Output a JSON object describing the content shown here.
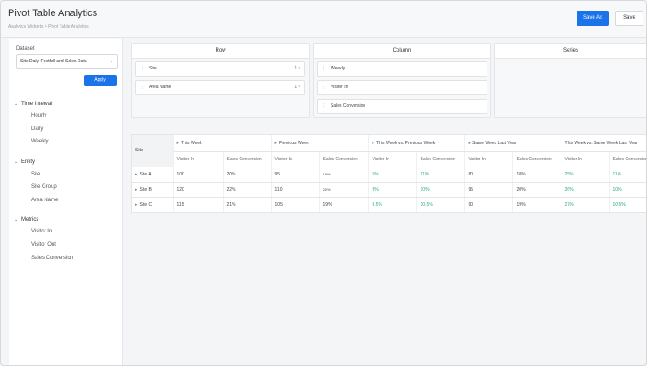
{
  "header": {
    "title": "Pivot Table Analytics",
    "breadcrumb": "Analytics Widgets  >  Pivot Table Analytics",
    "save_as_label": "Save As",
    "save_label": "Save"
  },
  "sidebar": {
    "dataset_label": "Dataset",
    "dataset_value": "Site Daily Footfall and Sales Data",
    "apply_label": "Apply",
    "groups": [
      {
        "label": "Time Interval",
        "items": [
          "Hourly",
          "Daily",
          "Weekly"
        ]
      },
      {
        "label": "Entity",
        "items": [
          "Site",
          "Site Group",
          "Area Name"
        ]
      },
      {
        "label": "Metrics",
        "items": [
          "Visitor In",
          "Visitor Out",
          "Sales Conversion"
        ]
      }
    ]
  },
  "zones": {
    "row": {
      "title": "Row",
      "chips": [
        "Site",
        "Area Name"
      ],
      "chip_index": "1"
    },
    "column": {
      "title": "Column",
      "chips": [
        "Weekly",
        "Visitor In",
        "Sales Conversion"
      ]
    },
    "series": {
      "title": "Series"
    }
  },
  "table": {
    "row_header": "Site",
    "groups": [
      "This Week",
      "Previous Week",
      "This Week vs. Previous Week",
      "Same Week Last Year",
      "This Week vs. Same Week Last Year"
    ],
    "subheaders": [
      "Visitor In",
      "Sales Conversion"
    ],
    "rows": [
      {
        "site": "Site A",
        "cells": [
          "100",
          "20%",
          "95",
          "18%",
          "5%",
          "11%",
          "80",
          "18%",
          "25%",
          "11%"
        ]
      },
      {
        "site": "Site B",
        "cells": [
          "120",
          "22%",
          "110",
          "20%",
          "9%",
          "10%",
          "95",
          "20%",
          "26%",
          "10%"
        ]
      },
      {
        "site": "Site C",
        "cells": [
          "115",
          "21%",
          "105",
          "19%",
          "9.5%",
          "10.5%",
          "90",
          "19%",
          "27%",
          "10.5%"
        ]
      }
    ]
  },
  "colors": {
    "accent": "#1a73e8",
    "positive": "#2eaa7a"
  }
}
